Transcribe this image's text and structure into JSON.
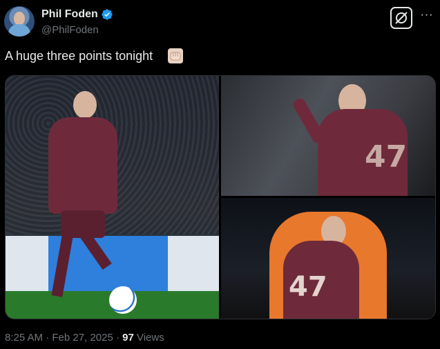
{
  "author": {
    "name": "Phil Foden",
    "handle": "@PhilFoden",
    "verified": true
  },
  "header_buttons": {
    "grok_icon": "grok-icon",
    "more_label": "···"
  },
  "tweet": {
    "text": "A huge three points tonight",
    "emoji": "fist-bump-emoji"
  },
  "media": {
    "photo_count": 3
  },
  "meta": {
    "time": "8:25 AM",
    "separator1": " · ",
    "date": "Feb 27, 2025",
    "separator2": " · ",
    "views_count": "97",
    "views_label": " Views"
  },
  "colors": {
    "background": "#000000",
    "text_primary": "#e7e9ea",
    "text_secondary": "#71767b",
    "verified_blue": "#1d9bf0",
    "border": "#2f3336"
  }
}
